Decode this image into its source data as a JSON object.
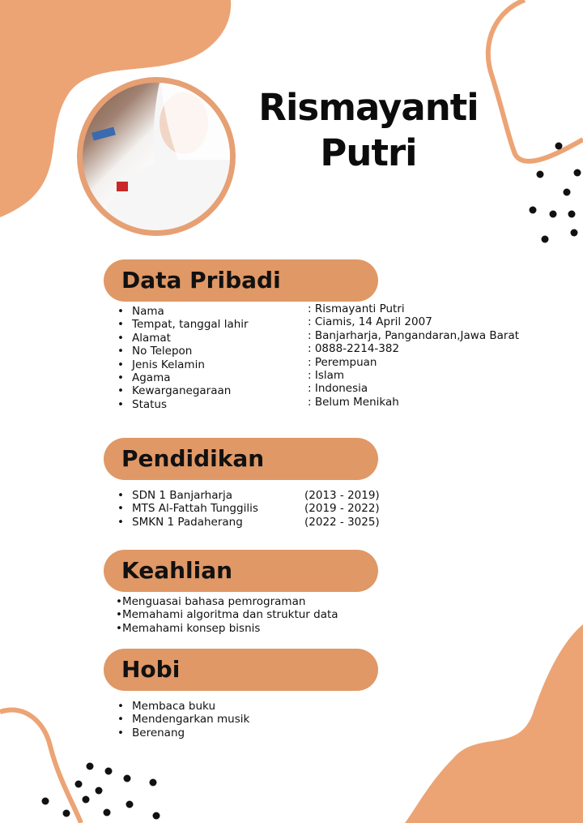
{
  "profile": {
    "name_line1": "Rismayanti",
    "name_line2": "Putri"
  },
  "colors": {
    "accent": "#e09866",
    "blob": "#eca475",
    "text": "#111111"
  },
  "data_pribadi": {
    "heading": "Data Pribadi",
    "fields": [
      {
        "label": "Nama",
        "value": ": Rismayanti Putri"
      },
      {
        "label": "Tempat, tanggal lahir",
        "value": ": Ciamis, 14 April 2007"
      },
      {
        "label": "Alamat",
        "value": ": Banjarharja, Pangandaran,Jawa Barat"
      },
      {
        "label": "No Telepon",
        "value": ": 0888-2214-382"
      },
      {
        "label": "Jenis Kelamin",
        "value": ": Perempuan"
      },
      {
        "label": "Agama",
        "value": ": Islam"
      },
      {
        "label": "Kewarganegaraan",
        "value": ": Indonesia"
      },
      {
        "label": "Status",
        "value": ": Belum Menikah"
      }
    ]
  },
  "pendidikan": {
    "heading": "Pendidikan",
    "items": [
      {
        "school": "SDN 1 Banjarharja",
        "years": "(2013 - 2019)"
      },
      {
        "school": "MTS Al-Fattah Tunggilis",
        "years": "(2019 - 2022)"
      },
      {
        "school": "SMKN 1 Padaherang",
        "years": "(2022 - 3025)"
      }
    ]
  },
  "keahlian": {
    "heading": "Keahlian",
    "items": [
      "•Menguasai bahasa pemrograman",
      "•Memahami algoritma dan struktur data",
      "•Memahami konsep bisnis"
    ]
  },
  "hobi": {
    "heading": "Hobi",
    "items": [
      "Membaca buku",
      "Mendengarkan musik",
      "Berenang"
    ]
  }
}
